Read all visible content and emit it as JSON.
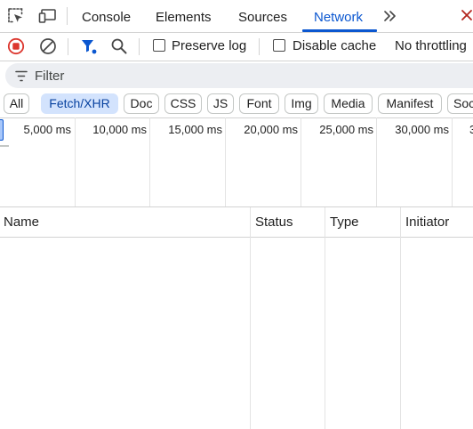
{
  "tabs": [
    {
      "label": "Console"
    },
    {
      "label": "Elements"
    },
    {
      "label": "Sources"
    },
    {
      "label": "Network"
    }
  ],
  "toolbar": {
    "preserve_log_label": "Preserve log",
    "preserve_log_checked": false,
    "disable_cache_label": "Disable cache",
    "disable_cache_checked": false,
    "throttling_value": "No throttling"
  },
  "filter": {
    "placeholder": "Filter"
  },
  "type_filters": [
    "All",
    "Fetch/XHR",
    "Doc",
    "CSS",
    "JS",
    "Font",
    "Img",
    "Media",
    "Manifest",
    "Soc"
  ],
  "active_type_filter": "Fetch/XHR",
  "overview": {
    "tick_labels": [
      "5,000 ms",
      "10,000 ms",
      "15,000 ms",
      "20,000 ms",
      "25,000 ms",
      "30,000 ms",
      "3"
    ]
  },
  "table": {
    "columns": [
      "Name",
      "Status",
      "Type",
      "Initiator"
    ],
    "rows": []
  },
  "colors": {
    "accent": "#0b57d0",
    "record_red": "#dc362e",
    "chip_active_bg": "#d3e3fd"
  }
}
